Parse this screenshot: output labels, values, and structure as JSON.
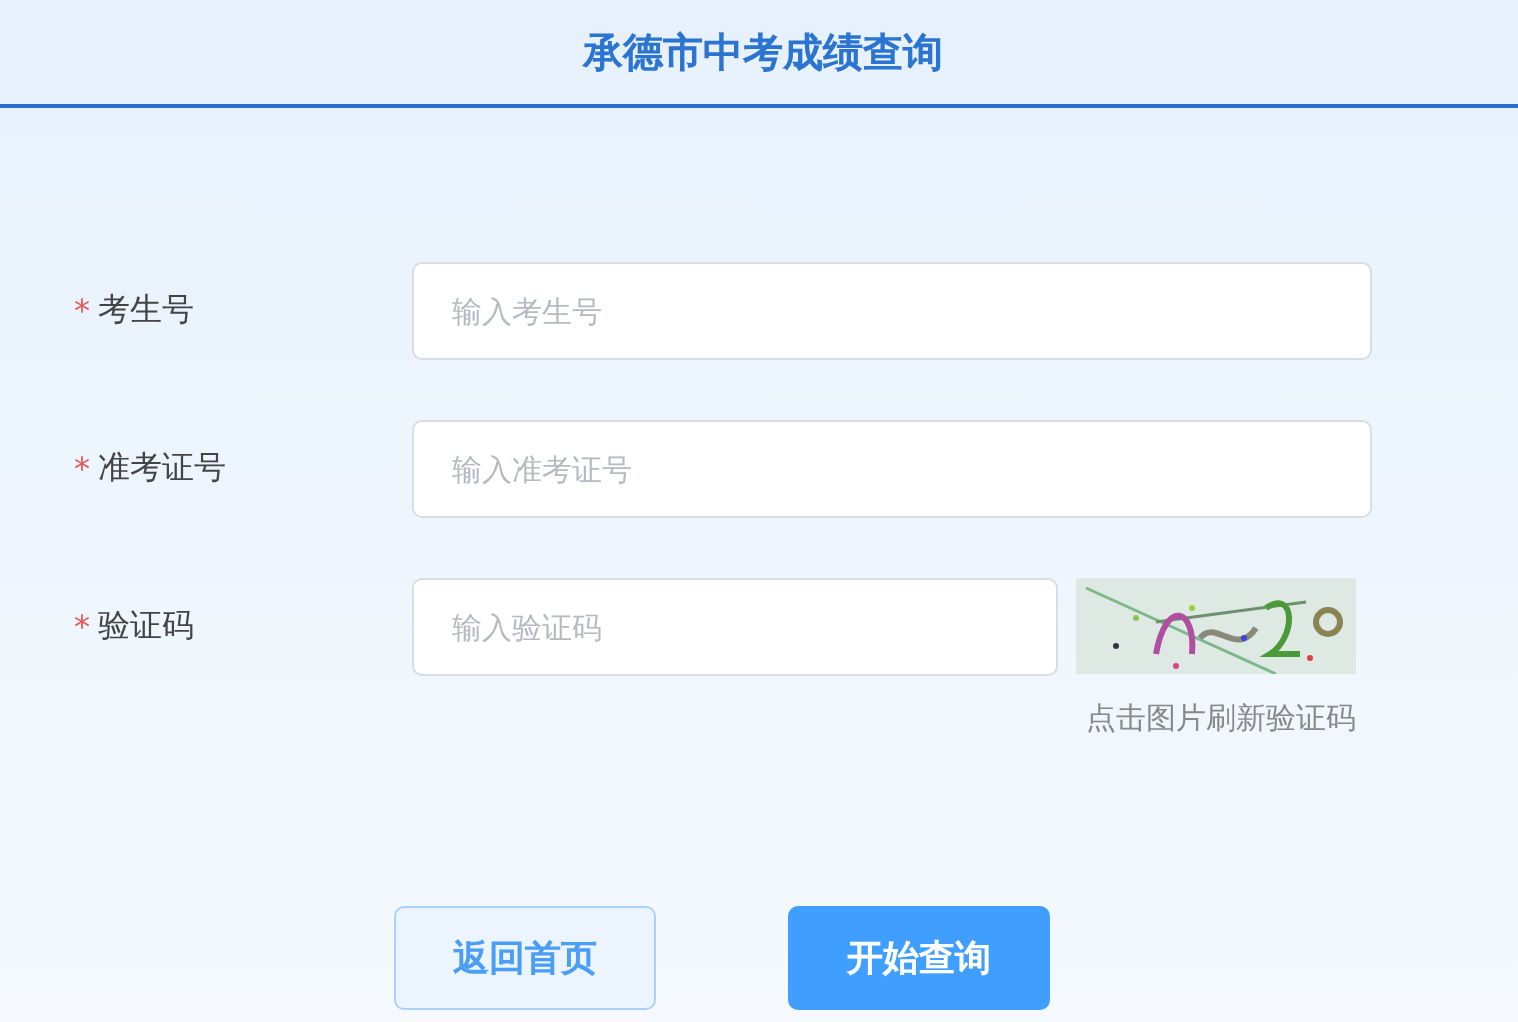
{
  "header": {
    "title": "承德市中考成绩查询"
  },
  "fields": [
    {
      "kind": "text",
      "required_mark": "*",
      "label": "考生号",
      "placeholder": "输入考生号"
    },
    {
      "kind": "text",
      "required_mark": "*",
      "label": "准考证号",
      "placeholder": "输入准考证号"
    },
    {
      "kind": "captcha",
      "required_mark": "*",
      "label": "验证码",
      "placeholder": "输入验证码",
      "hint": "点击图片刷新验证码"
    }
  ],
  "buttons": [
    {
      "kind": "secondary",
      "label": "返回首页"
    },
    {
      "kind": "primary",
      "label": "开始查询"
    }
  ]
}
